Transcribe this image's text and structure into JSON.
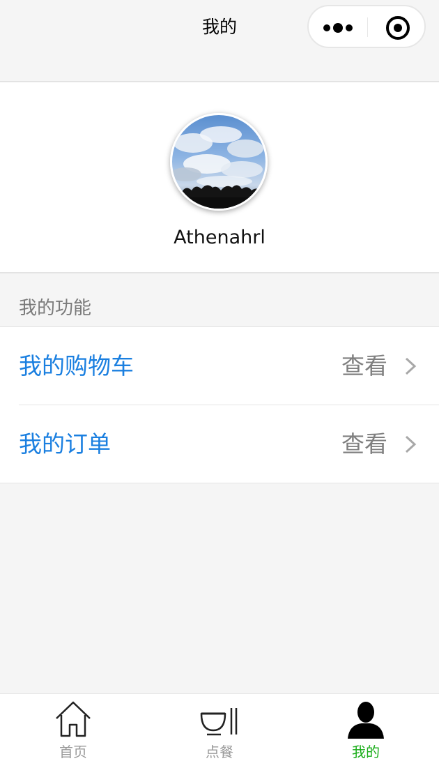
{
  "navbar": {
    "title": "我的"
  },
  "profile": {
    "username": "Athenahrl"
  },
  "section": {
    "title": "我的功能"
  },
  "menu": {
    "items": [
      {
        "label": "我的购物车",
        "action": "查看"
      },
      {
        "label": "我的订单",
        "action": "查看"
      }
    ]
  },
  "tabbar": {
    "tabs": [
      {
        "label": "首页",
        "icon": "home-icon",
        "active": false
      },
      {
        "label": "点餐",
        "icon": "bowl-utensils-icon",
        "active": false
      },
      {
        "label": "我的",
        "icon": "user-icon",
        "active": true
      }
    ]
  },
  "colors": {
    "accent_blue": "#1a7fe0",
    "active_green": "#1aad19",
    "inactive_gray": "#9a9a9a",
    "background": "#f5f5f5"
  }
}
